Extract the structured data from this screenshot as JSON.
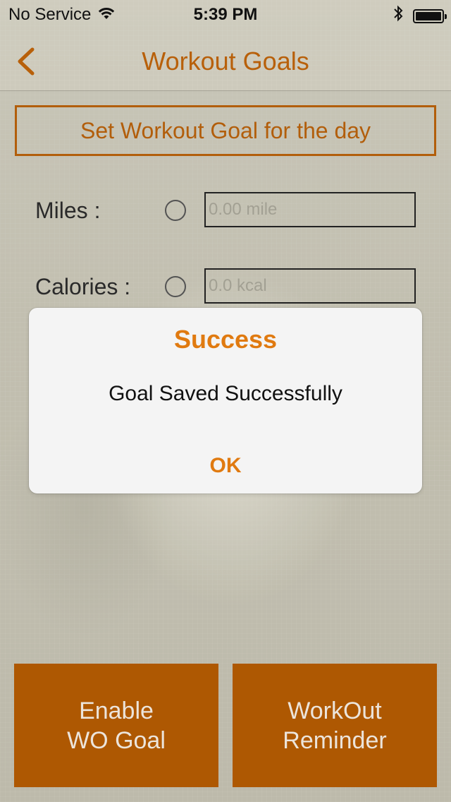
{
  "status_bar": {
    "carrier": "No Service",
    "time": "5:39 PM"
  },
  "nav": {
    "title": "Workout Goals"
  },
  "goal_header": "Set Workout Goal for the day",
  "rows": [
    {
      "label": "Miles :",
      "placeholder": "0.00 mile"
    },
    {
      "label": "Calories :",
      "placeholder": "0.0 kcal"
    }
  ],
  "alert": {
    "title": "Success",
    "message": "Goal Saved Successfully",
    "ok": "OK"
  },
  "buttons": {
    "enable_line1": "Enable",
    "enable_line2": "WO Goal",
    "reminder_line1": "WorkOut",
    "reminder_line2": "Reminder"
  },
  "colors": {
    "accent": "#b8600a",
    "alert_accent": "#e07a10",
    "button_bg": "#b35a00"
  }
}
